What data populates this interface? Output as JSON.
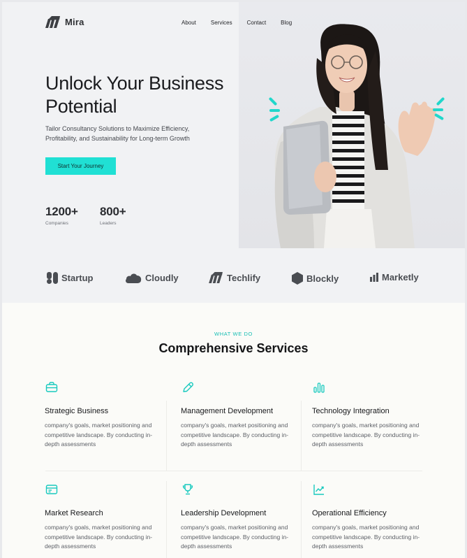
{
  "header": {
    "brand": "Mira",
    "nav": [
      "About",
      "Services",
      "Contact",
      "Blog"
    ]
  },
  "hero": {
    "title": "Unlock Your Business Potential",
    "subtitle": "Tailor Consultancy Solutions to Maximize Efficiency, Profitability, and Sustainability for Long-term Growth",
    "cta_label": "Start Your Journey",
    "stats": [
      {
        "value": "1200+",
        "label": "Companies"
      },
      {
        "value": "800+",
        "label": "Leaders"
      }
    ]
  },
  "brands": [
    {
      "name": "Startup",
      "icon": "startup-logo-icon"
    },
    {
      "name": "Cloudly",
      "icon": "cloud-logo-icon"
    },
    {
      "name": "Techlify",
      "icon": "techlify-logo-icon"
    },
    {
      "name": "Blockly",
      "icon": "hexagon-logo-icon"
    },
    {
      "name": "Marketly",
      "icon": "bar-chart-logo-icon"
    }
  ],
  "services": {
    "eyebrow": "WHAT WE DO",
    "title": "Comprehensive Services",
    "items": [
      {
        "title": "Strategic Business",
        "text": "company's goals, market positioning and competitive landscape. By conducting in-depth assessments",
        "icon": "briefcase-icon"
      },
      {
        "title": "Management Development",
        "text": "company's goals, market positioning and competitive landscape. By conducting in-depth assessments",
        "icon": "pen-icon"
      },
      {
        "title": "Technology Integration",
        "text": "company's goals, market positioning and competitive landscape. By conducting in-depth assessments",
        "icon": "bar-chart-icon"
      },
      {
        "title": "Market Research",
        "text": "company's goals, market positioning and competitive landscape. By conducting in-depth assessments",
        "icon": "browser-window-icon"
      },
      {
        "title": "Leadership Development",
        "text": "company's goals, market positioning and competitive landscape. By conducting in-depth assessments",
        "icon": "trophy-icon"
      },
      {
        "title": "Operational Efficiency",
        "text": "company's goals, market positioning and competitive landscape. By conducting in-depth assessments",
        "icon": "line-chart-icon"
      }
    ]
  },
  "colors": {
    "accent": "#20e0d4",
    "accent_text": "#16bdb3",
    "hero_bg": "#f1f2f4",
    "page_bg": "#fbfbf8"
  }
}
